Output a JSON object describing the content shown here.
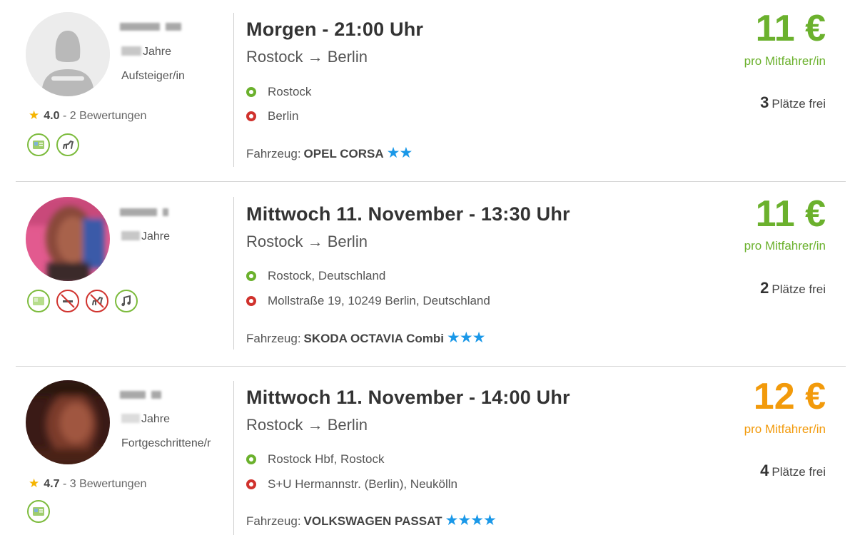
{
  "listings": [
    {
      "age_label": "Jahre",
      "level": "Aufsteiger/in",
      "rating": "4.0",
      "reviews": "- 2 Bewertungen",
      "badges": [
        "license-icon",
        "pet-icon"
      ],
      "title": "Morgen - 21:00 Uhr",
      "route": "Rostock → Berlin",
      "start": "Rostock",
      "end": "Berlin",
      "vehicle_label": "Fahrzeug:",
      "vehicle": "OPEL CORSA",
      "vehicle_stars": "★★",
      "price": "11 €",
      "price_unit": "pro Mitfahrer/in",
      "price_color": "#6bb12d",
      "seats": "3",
      "seats_label": "Plätze frei"
    },
    {
      "age_label": "Jahre",
      "level": "",
      "rating": "",
      "reviews": "",
      "badges": [
        "license-icon",
        "no-smoking-icon",
        "no-pets-icon",
        "music-icon"
      ],
      "title": "Mittwoch 11. November - 13:30 Uhr",
      "route": "Rostock → Berlin",
      "start": "Rostock, Deutschland",
      "end": "Mollstraße 19, 10249 Berlin, Deutschland",
      "vehicle_label": "Fahrzeug:",
      "vehicle": "SKODA OCTAVIA Combi",
      "vehicle_stars": "★★★",
      "price": "11 €",
      "price_unit": "pro Mitfahrer/in",
      "price_color": "#6bb12d",
      "seats": "2",
      "seats_label": "Plätze frei"
    },
    {
      "age_label": "Jahre",
      "level": "Fortgeschrittene/r",
      "rating": "4.7",
      "reviews": "- 3 Bewertungen",
      "badges": [
        "license-icon"
      ],
      "title": "Mittwoch 11. November - 14:00 Uhr",
      "route": "Rostock → Berlin",
      "start": "Rostock Hbf, Rostock",
      "end": "S+U Hermannstr. (Berlin), Neukölln",
      "vehicle_label": "Fahrzeug:",
      "vehicle": "VOLKSWAGEN PASSAT",
      "vehicle_stars": "★★★★",
      "price": "12 €",
      "price_unit": "pro Mitfahrer/in",
      "price_color": "#f29a0b",
      "seats": "4",
      "seats_label": "Plätze frei"
    }
  ]
}
